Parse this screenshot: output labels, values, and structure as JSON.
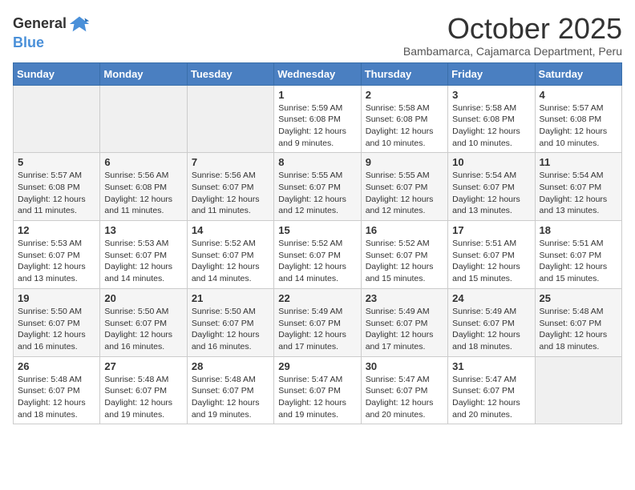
{
  "logo": {
    "general": "General",
    "blue": "Blue"
  },
  "title": "October 2025",
  "subtitle": "Bambamarca, Cajamarca Department, Peru",
  "days_of_week": [
    "Sunday",
    "Monday",
    "Tuesday",
    "Wednesday",
    "Thursday",
    "Friday",
    "Saturday"
  ],
  "weeks": [
    [
      {
        "day": "",
        "info": ""
      },
      {
        "day": "",
        "info": ""
      },
      {
        "day": "",
        "info": ""
      },
      {
        "day": "1",
        "info": "Sunrise: 5:59 AM\nSunset: 6:08 PM\nDaylight: 12 hours and 9 minutes."
      },
      {
        "day": "2",
        "info": "Sunrise: 5:58 AM\nSunset: 6:08 PM\nDaylight: 12 hours and 10 minutes."
      },
      {
        "day": "3",
        "info": "Sunrise: 5:58 AM\nSunset: 6:08 PM\nDaylight: 12 hours and 10 minutes."
      },
      {
        "day": "4",
        "info": "Sunrise: 5:57 AM\nSunset: 6:08 PM\nDaylight: 12 hours and 10 minutes."
      }
    ],
    [
      {
        "day": "5",
        "info": "Sunrise: 5:57 AM\nSunset: 6:08 PM\nDaylight: 12 hours and 11 minutes."
      },
      {
        "day": "6",
        "info": "Sunrise: 5:56 AM\nSunset: 6:08 PM\nDaylight: 12 hours and 11 minutes."
      },
      {
        "day": "7",
        "info": "Sunrise: 5:56 AM\nSunset: 6:07 PM\nDaylight: 12 hours and 11 minutes."
      },
      {
        "day": "8",
        "info": "Sunrise: 5:55 AM\nSunset: 6:07 PM\nDaylight: 12 hours and 12 minutes."
      },
      {
        "day": "9",
        "info": "Sunrise: 5:55 AM\nSunset: 6:07 PM\nDaylight: 12 hours and 12 minutes."
      },
      {
        "day": "10",
        "info": "Sunrise: 5:54 AM\nSunset: 6:07 PM\nDaylight: 12 hours and 13 minutes."
      },
      {
        "day": "11",
        "info": "Sunrise: 5:54 AM\nSunset: 6:07 PM\nDaylight: 12 hours and 13 minutes."
      }
    ],
    [
      {
        "day": "12",
        "info": "Sunrise: 5:53 AM\nSunset: 6:07 PM\nDaylight: 12 hours and 13 minutes."
      },
      {
        "day": "13",
        "info": "Sunrise: 5:53 AM\nSunset: 6:07 PM\nDaylight: 12 hours and 14 minutes."
      },
      {
        "day": "14",
        "info": "Sunrise: 5:52 AM\nSunset: 6:07 PM\nDaylight: 12 hours and 14 minutes."
      },
      {
        "day": "15",
        "info": "Sunrise: 5:52 AM\nSunset: 6:07 PM\nDaylight: 12 hours and 14 minutes."
      },
      {
        "day": "16",
        "info": "Sunrise: 5:52 AM\nSunset: 6:07 PM\nDaylight: 12 hours and 15 minutes."
      },
      {
        "day": "17",
        "info": "Sunrise: 5:51 AM\nSunset: 6:07 PM\nDaylight: 12 hours and 15 minutes."
      },
      {
        "day": "18",
        "info": "Sunrise: 5:51 AM\nSunset: 6:07 PM\nDaylight: 12 hours and 15 minutes."
      }
    ],
    [
      {
        "day": "19",
        "info": "Sunrise: 5:50 AM\nSunset: 6:07 PM\nDaylight: 12 hours and 16 minutes."
      },
      {
        "day": "20",
        "info": "Sunrise: 5:50 AM\nSunset: 6:07 PM\nDaylight: 12 hours and 16 minutes."
      },
      {
        "day": "21",
        "info": "Sunrise: 5:50 AM\nSunset: 6:07 PM\nDaylight: 12 hours and 16 minutes."
      },
      {
        "day": "22",
        "info": "Sunrise: 5:49 AM\nSunset: 6:07 PM\nDaylight: 12 hours and 17 minutes."
      },
      {
        "day": "23",
        "info": "Sunrise: 5:49 AM\nSunset: 6:07 PM\nDaylight: 12 hours and 17 minutes."
      },
      {
        "day": "24",
        "info": "Sunrise: 5:49 AM\nSunset: 6:07 PM\nDaylight: 12 hours and 18 minutes."
      },
      {
        "day": "25",
        "info": "Sunrise: 5:48 AM\nSunset: 6:07 PM\nDaylight: 12 hours and 18 minutes."
      }
    ],
    [
      {
        "day": "26",
        "info": "Sunrise: 5:48 AM\nSunset: 6:07 PM\nDaylight: 12 hours and 18 minutes."
      },
      {
        "day": "27",
        "info": "Sunrise: 5:48 AM\nSunset: 6:07 PM\nDaylight: 12 hours and 19 minutes."
      },
      {
        "day": "28",
        "info": "Sunrise: 5:48 AM\nSunset: 6:07 PM\nDaylight: 12 hours and 19 minutes."
      },
      {
        "day": "29",
        "info": "Sunrise: 5:47 AM\nSunset: 6:07 PM\nDaylight: 12 hours and 19 minutes."
      },
      {
        "day": "30",
        "info": "Sunrise: 5:47 AM\nSunset: 6:07 PM\nDaylight: 12 hours and 20 minutes."
      },
      {
        "day": "31",
        "info": "Sunrise: 5:47 AM\nSunset: 6:07 PM\nDaylight: 12 hours and 20 minutes."
      },
      {
        "day": "",
        "info": ""
      }
    ]
  ]
}
